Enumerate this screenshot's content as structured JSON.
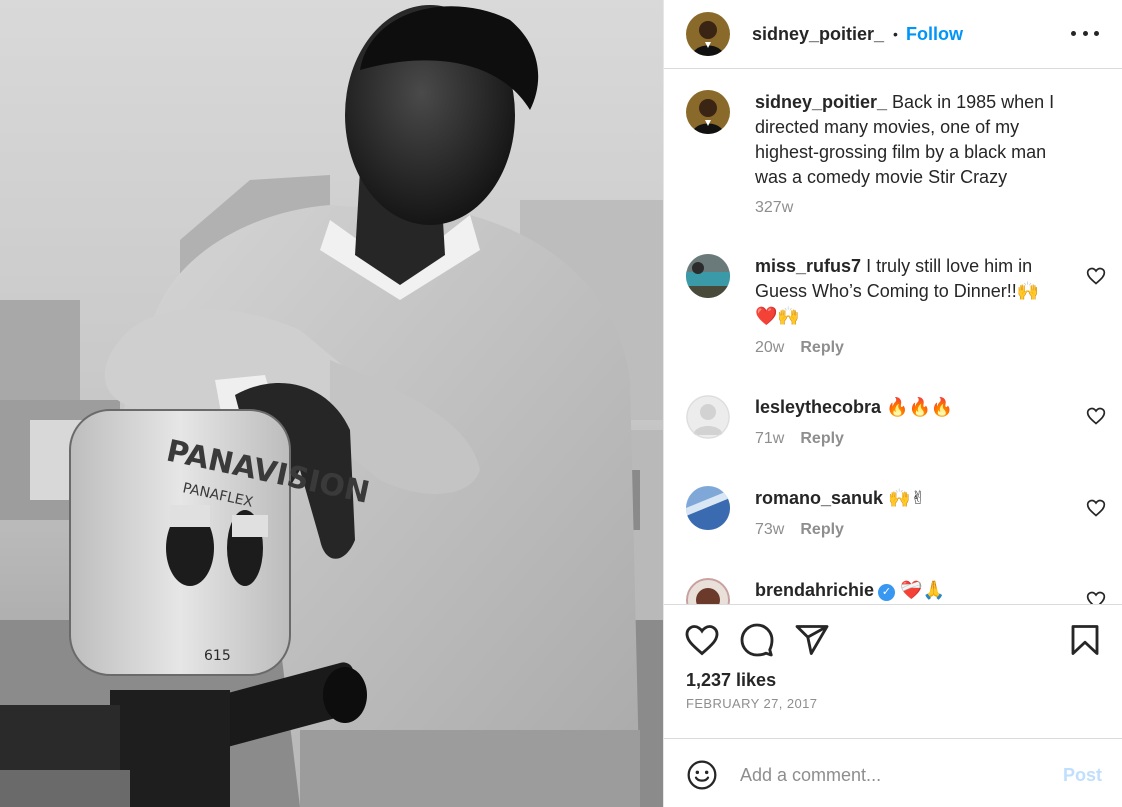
{
  "post": {
    "image_alt": "Black and white photo of a man leaning on a Panavision film camera",
    "camera_brand": "PANAVISION",
    "camera_model": "PANAFLEX",
    "camera_tag": "615"
  },
  "header": {
    "username": "sidney_poitier_",
    "separator": "•",
    "follow_label": "Follow",
    "more_icon": "more-options-icon"
  },
  "caption": {
    "username": "sidney_poitier_",
    "text": "Back in 1985 when I directed many movies, one of my highest-grossing film by a black man was a comedy movie Stir Crazy",
    "time": "327w"
  },
  "comments": [
    {
      "username": "miss_rufus7",
      "text": "I truly still love him in Guess Who’s Coming to Dinner!!",
      "emoji": "🙌",
      "emoji2": "❤️🙌",
      "time": "20w",
      "reply_label": "Reply"
    },
    {
      "username": "lesleythecobra",
      "text": "",
      "emoji": "🔥🔥🔥",
      "time": "71w",
      "reply_label": "Reply"
    },
    {
      "username": "romano_sanuk",
      "text": "",
      "emoji": "🙌✌",
      "time": "73w",
      "reply_label": "Reply"
    },
    {
      "username": "brendahrichie",
      "text": "",
      "emoji": "❤️‍🩹🙏",
      "verified": "✓"
    }
  ],
  "actions": {
    "like_icon": "heart-icon",
    "comment_icon": "comment-bubble-icon",
    "share_icon": "paper-plane-icon",
    "save_icon": "bookmark-icon",
    "likes": "1,237 likes",
    "date": "FEBRUARY 27, 2017"
  },
  "add_comment": {
    "placeholder": "Add a comment...",
    "post_label": "Post",
    "emoji_icon": "smiley-face-icon"
  },
  "colors": {
    "follow_blue": "#0095f6",
    "post_disabled": "#c0dffd",
    "secondary_text": "#8e8e8e",
    "border": "#dbdbdb"
  }
}
